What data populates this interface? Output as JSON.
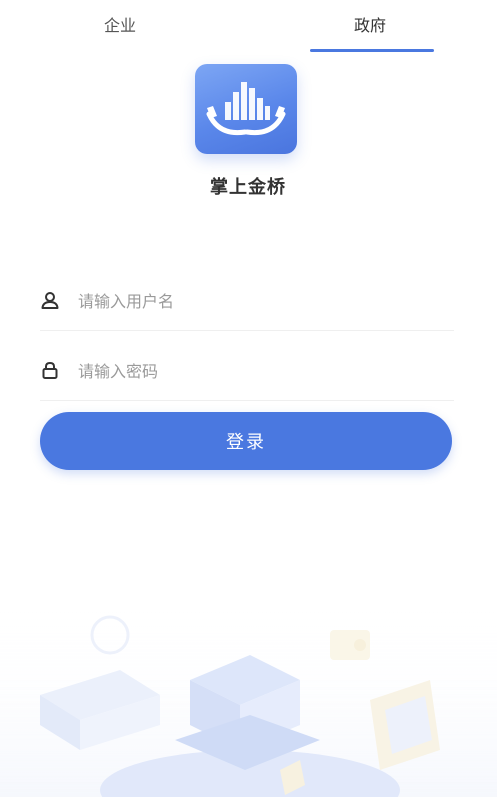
{
  "tabs": [
    {
      "label": "企业",
      "active": false
    },
    {
      "label": "政府",
      "active": true
    }
  ],
  "app": {
    "name": "掌上金桥"
  },
  "login": {
    "username_placeholder": "请输入用户名",
    "password_placeholder": "请输入密码",
    "submit_label": "登录"
  },
  "colors": {
    "accent": "#4a78e0",
    "divider": "#efefef",
    "placeholder": "#9a9a9a"
  }
}
